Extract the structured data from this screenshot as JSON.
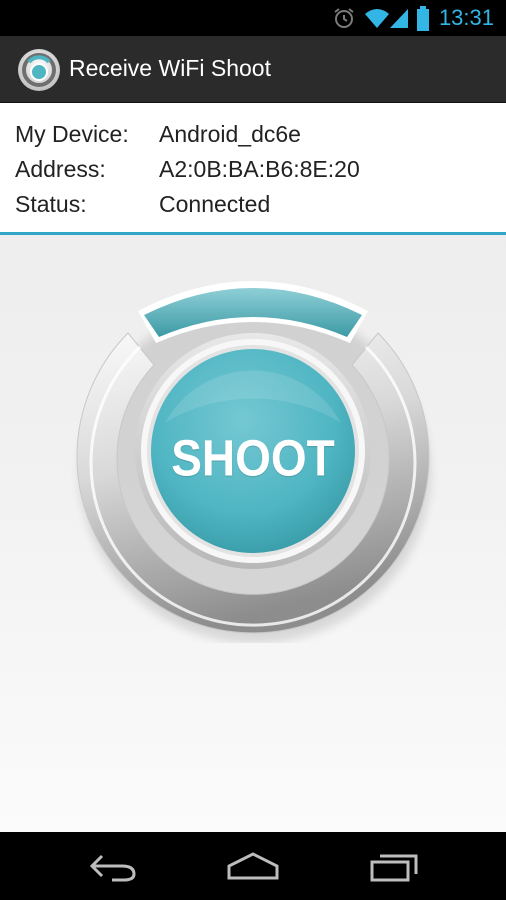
{
  "status_bar": {
    "time": "13:31",
    "icons": [
      "alarm-icon",
      "wifi-icon",
      "signal-icon",
      "battery-icon"
    ]
  },
  "action_bar": {
    "title": "Receive WiFi Shoot",
    "icon": "app-logo-icon"
  },
  "device_info": {
    "rows": [
      {
        "label": "My Device:",
        "value": "Android_dc6e"
      },
      {
        "label": "Address:",
        "value": "A2:0B:BA:B6:8E:20"
      },
      {
        "label": "Status:",
        "value": "Connected"
      }
    ]
  },
  "shoot_button": {
    "label": "SHOOT"
  },
  "nav_bar": {
    "buttons": [
      "back-icon",
      "home-icon",
      "recent-apps-icon"
    ]
  },
  "colors": {
    "accent": "#31a6c8",
    "button": "#4fb5c2",
    "status_icons": "#33b5e5"
  }
}
